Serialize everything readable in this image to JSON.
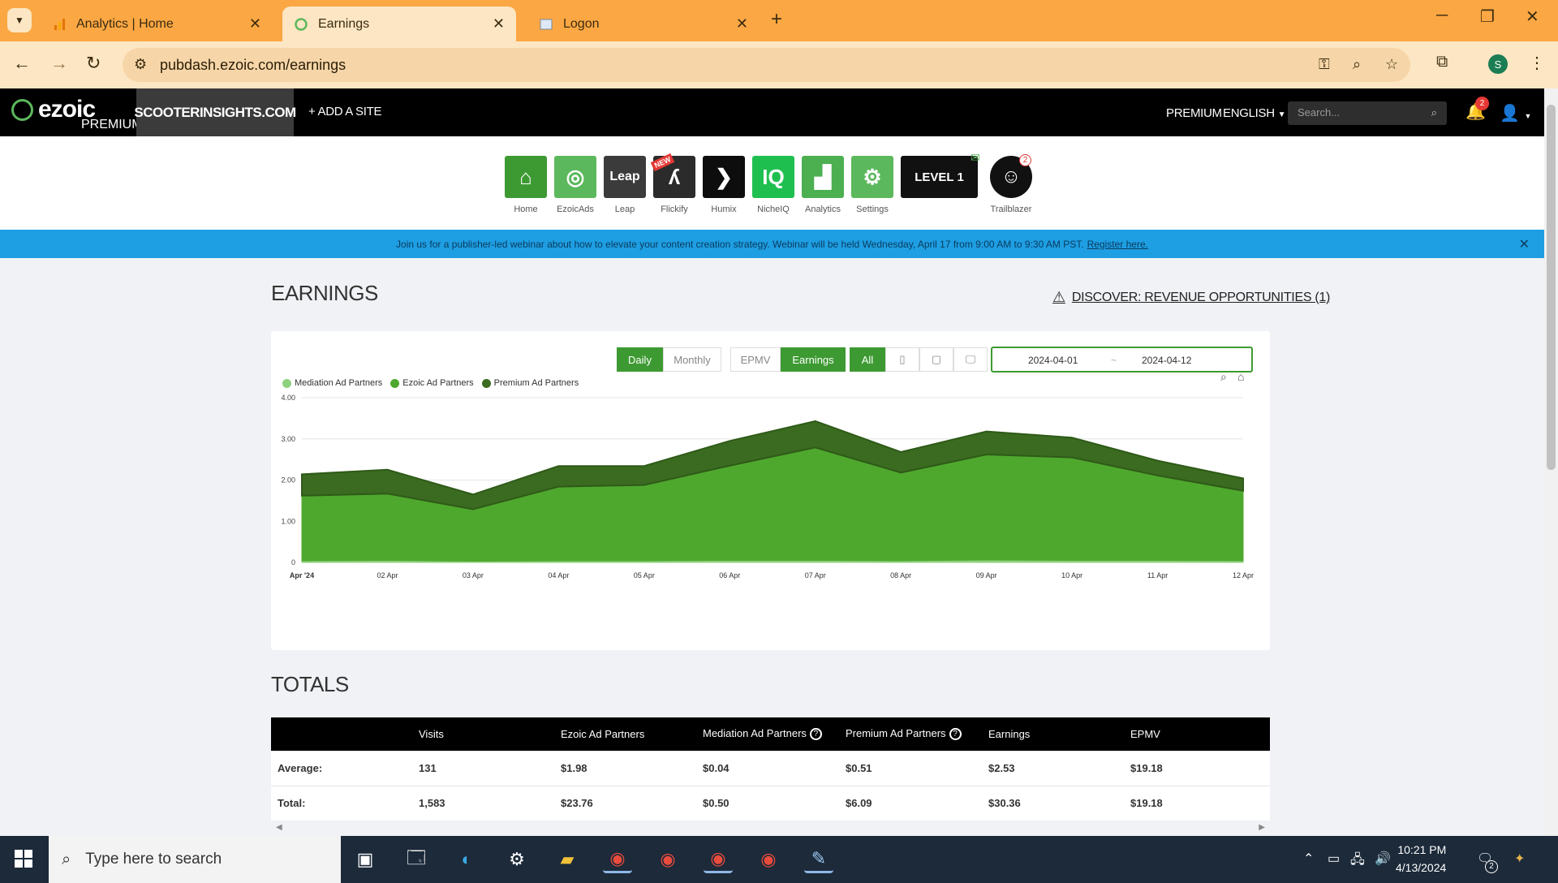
{
  "browser": {
    "tabs": [
      {
        "title": "Analytics | Home",
        "icon": "analytics-icon"
      },
      {
        "title": "Earnings",
        "icon": "ezoic-icon"
      },
      {
        "title": "Logon",
        "icon": "page-icon"
      }
    ],
    "url": "pubdash.ezoic.com/earnings",
    "profile_initial": "S"
  },
  "header": {
    "logo_text": "ezoic",
    "logo_tag": "PREMIUM",
    "site": "SCOOTERINSIGHTS.COM",
    "add_site": "+ ADD A SITE",
    "premium": "PREMIUM",
    "language": "ENGLISH",
    "search_placeholder": "Search...",
    "notification_count": "2"
  },
  "apps": [
    {
      "label": "Home",
      "color": "#3d9a32",
      "glyph": "⌂"
    },
    {
      "label": "EzoicAds",
      "color": "#5cb85c",
      "glyph": "◎"
    },
    {
      "label": "Leap",
      "color": "#3b3b3b",
      "glyph": "Leap"
    },
    {
      "label": "Flickify",
      "color": "#2b2b2b",
      "glyph": "ʎ"
    },
    {
      "label": "Humix",
      "color": "#0d0d0d",
      "glyph": "❯"
    },
    {
      "label": "NicheIQ",
      "color": "#1fbf4f",
      "glyph": "IQ"
    },
    {
      "label": "Analytics",
      "color": "#4caf50",
      "glyph": "▟"
    },
    {
      "label": "Settings",
      "color": "#5cb85c",
      "glyph": "⚙"
    }
  ],
  "flickify_badge": "NEW",
  "level_label": "LEVEL 1",
  "trailblazer": {
    "label": "Trailblazer",
    "count": "2"
  },
  "banner": {
    "text": "Join us for a publisher-led webinar about how to elevate your content creation strategy. Webinar will be held Wednesday, April 17 from 9:00 AM to 9:30 AM PST.",
    "link": "Register here."
  },
  "page": {
    "title": "EARNINGS",
    "discover": "DISCOVER: REVENUE OPPORTUNITIES (1)"
  },
  "controls": {
    "daily": "Daily",
    "monthly": "Monthly",
    "epmv": "EPMV",
    "earnings": "Earnings",
    "all": "All",
    "date_start": "2024-04-01",
    "date_sep": "~",
    "date_end": "2024-04-12"
  },
  "chart_data": {
    "type": "area",
    "stacked": true,
    "categories": [
      "Apr '24",
      "02 Apr",
      "03 Apr",
      "04 Apr",
      "05 Apr",
      "06 Apr",
      "07 Apr",
      "08 Apr",
      "09 Apr",
      "10 Apr",
      "11 Apr",
      "12 Apr"
    ],
    "series": [
      {
        "name": "Mediation Ad Partners",
        "color": "#8fd17e",
        "values": [
          0.04,
          0.05,
          0.03,
          0.04,
          0.04,
          0.05,
          0.05,
          0.04,
          0.06,
          0.05,
          0.05,
          0.04
        ]
      },
      {
        "name": "Ezoic Ad Partners",
        "color": "#4fa82e",
        "values": [
          1.58,
          1.62,
          1.26,
          1.8,
          1.84,
          2.3,
          2.74,
          2.14,
          2.56,
          2.5,
          2.06,
          1.7
        ]
      },
      {
        "name": "Premium Ad Partners",
        "color": "#3a6b20",
        "values": [
          0.52,
          0.58,
          0.36,
          0.5,
          0.46,
          0.6,
          0.64,
          0.5,
          0.56,
          0.48,
          0.36,
          0.3
        ]
      }
    ],
    "yticks": [
      "0",
      "1.00",
      "2.00",
      "3.00",
      "4.00"
    ],
    "ylim": [
      0,
      4
    ],
    "grid": true,
    "legend": "top-left"
  },
  "totals": {
    "title": "TOTALS",
    "columns": [
      "",
      "Visits",
      "Ezoic Ad Partners",
      "Mediation Ad Partners",
      "Premium Ad Partners",
      "Earnings",
      "EPMV"
    ],
    "rows": [
      [
        "Average:",
        "131",
        "$1.98",
        "$0.04",
        "$0.51",
        "$2.53",
        "$19.18"
      ],
      [
        "Total:",
        "1,583",
        "$23.76",
        "$0.50",
        "$6.09",
        "$30.36",
        "$19.18"
      ]
    ]
  },
  "taskbar": {
    "search_placeholder": "Type here to search",
    "time": "10:21 PM",
    "date": "4/13/2024",
    "notif_count": "2"
  }
}
